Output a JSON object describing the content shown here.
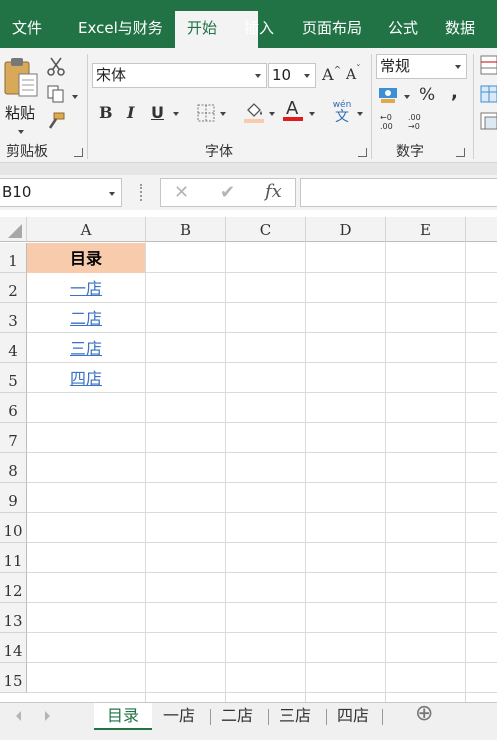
{
  "menu": {
    "tabs": [
      "文件",
      "Excel与财务",
      "开始",
      "插入",
      "页面布局",
      "公式",
      "数据"
    ],
    "active": "开始"
  },
  "ribbon": {
    "clipboard": {
      "paste_label": "粘贴",
      "group_label": "剪贴板"
    },
    "font": {
      "font_name": "宋体",
      "font_size": "10",
      "bold": "B",
      "italic": "I",
      "underline": "U",
      "font_color_glyph": "A",
      "grow_glyph": "A",
      "shrink_glyph": "A",
      "phonetic_glyph": "wén",
      "phonetic_sub": "文",
      "group_label": "字体"
    },
    "number": {
      "format": "常规",
      "percent": "%",
      "comma": ",",
      "inc_decimal": "←0 .00",
      "dec_decimal": ".00 →0",
      "group_label": "数字"
    }
  },
  "formula_bar": {
    "name_box": "B10",
    "cancel": "✕",
    "enter": "✔",
    "fx": "fx",
    "formula": ""
  },
  "grid": {
    "columns": [
      "A",
      "B",
      "C",
      "D",
      "E"
    ],
    "rows": [
      "1",
      "2",
      "3",
      "4",
      "5",
      "6",
      "7",
      "8",
      "9",
      "10",
      "11",
      "12",
      "13",
      "14",
      "15"
    ],
    "a1": "目录",
    "links": [
      "一店",
      "二店",
      "三店",
      "四店"
    ],
    "header_fill": "#f8cbad"
  },
  "sheet_tabs": {
    "tabs": [
      "目录",
      "一店",
      "二店",
      "三店",
      "四店"
    ],
    "active": "目录",
    "add": "⊕"
  }
}
